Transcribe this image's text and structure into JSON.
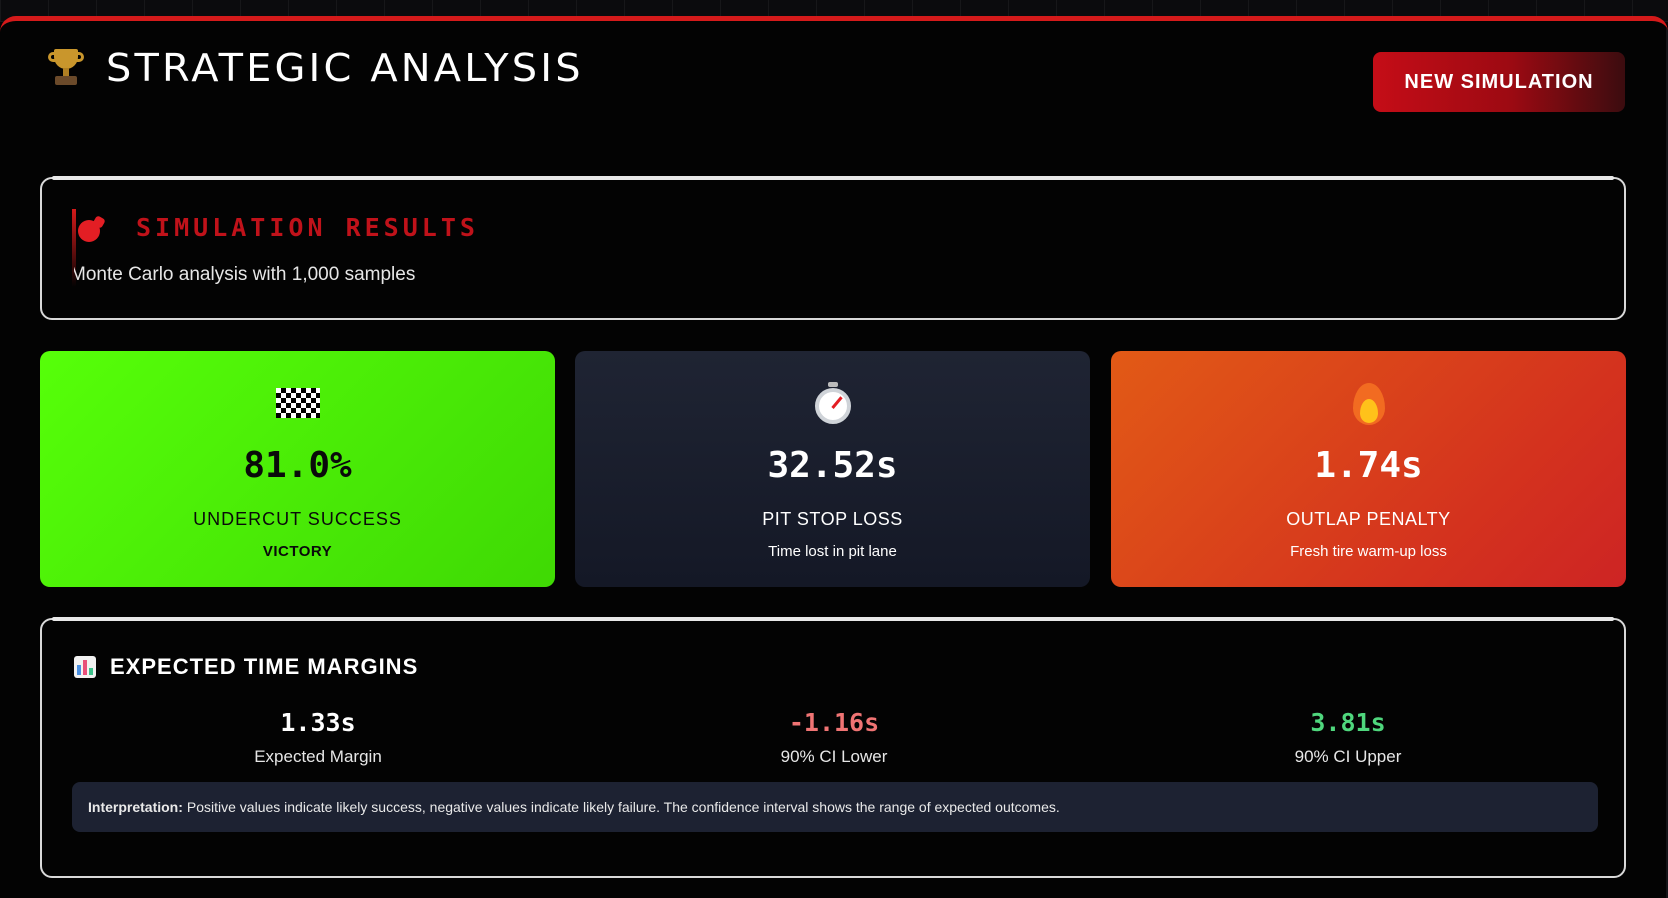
{
  "header": {
    "title": "STRATEGIC ANALYSIS",
    "icon": "trophy-icon",
    "new_simulation_label": "NEW SIMULATION"
  },
  "results": {
    "title": "SIMULATION RESULTS",
    "subtitle": "Monte Carlo analysis with 1,000 samples",
    "icon": "bomb-icon"
  },
  "metrics": [
    {
      "icon": "checkered-flag-icon",
      "value": "81.0%",
      "label": "UNDERCUT SUCCESS",
      "sub": "VICTORY"
    },
    {
      "icon": "stopwatch-icon",
      "value": "32.52s",
      "label": "PIT STOP LOSS",
      "sub": "Time lost in pit lane"
    },
    {
      "icon": "fire-icon",
      "value": "1.74s",
      "label": "OUTLAP PENALTY",
      "sub": "Fresh tire warm-up loss"
    }
  ],
  "margins": {
    "title": "EXPECTED TIME MARGINS",
    "icon": "bar-chart-icon",
    "items": [
      {
        "value": "1.33s",
        "label": "Expected Margin"
      },
      {
        "value": "-1.16s",
        "label": "90% CI Lower"
      },
      {
        "value": "3.81s",
        "label": "90% CI Upper"
      }
    ],
    "interpretation_label": "Interpretation:",
    "interpretation_text": "Positive values indicate likely success, negative values indicate likely failure. The confidence interval shows the range of expected outcomes."
  },
  "colors": {
    "accent_red": "#d51a1a",
    "success_green": "#56ff09",
    "negative": "#f07474",
    "positive": "#4fd77d"
  }
}
